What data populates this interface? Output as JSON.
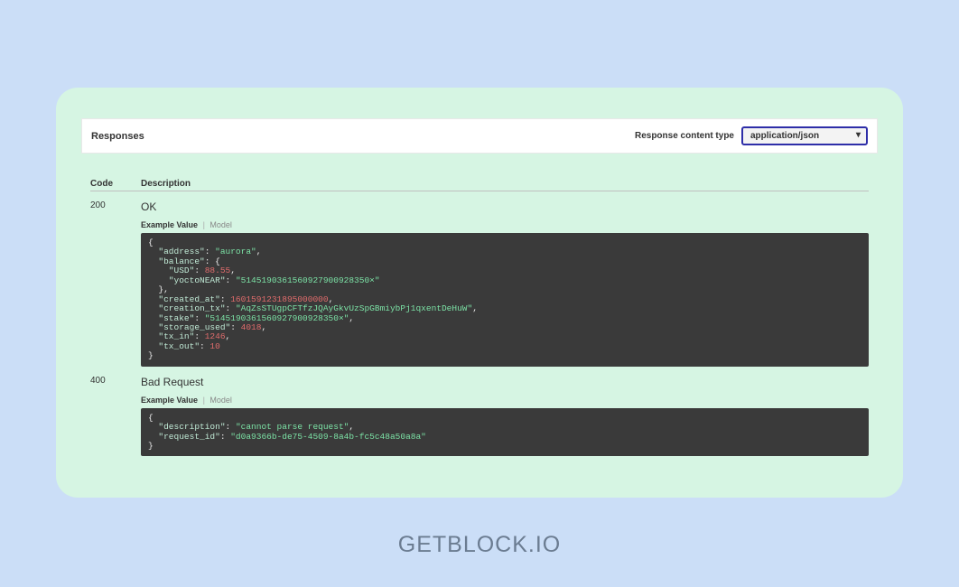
{
  "header": {
    "title": "Responses",
    "content_type_label": "Response content type",
    "content_type_value": "application/json"
  },
  "columns": {
    "code": "Code",
    "description": "Description"
  },
  "rows": [
    {
      "code": "200",
      "status": "OK",
      "tab_active": "Example Value",
      "tab_inactive": "Model",
      "example": {
        "address": "aurora",
        "balance": {
          "USD": 88.55,
          "yoctoNEAR": "5145190361560927900928350×"
        },
        "created_at": 1601591231895000000,
        "creation_tx": "AqZsSTUgpCFTfzJQAyGkvUzSpGBmiybPj1qxentDeHuW",
        "stake": "5145190361560927900928350×",
        "storage_used": 4018,
        "tx_in": 1246,
        "tx_out": 10
      }
    },
    {
      "code": "400",
      "status": "Bad Request",
      "tab_active": "Example Value",
      "tab_inactive": "Model",
      "example": {
        "description": "cannot parse request",
        "request_id": "d0a9366b-de75-4509-8a4b-fc5c48a50a8a"
      }
    }
  ],
  "brand": "GETBLOCK.IO",
  "code_tokens": {
    "r200": [
      {
        "c": "punct",
        "t": "{"
      },
      {
        "c": "punct",
        "t": "\n  "
      },
      {
        "c": "key",
        "t": "\"address\""
      },
      {
        "c": "punct",
        "t": ": "
      },
      {
        "c": "str",
        "t": "\"aurora\""
      },
      {
        "c": "punct",
        "t": ","
      },
      {
        "c": "punct",
        "t": "\n  "
      },
      {
        "c": "key",
        "t": "\"balance\""
      },
      {
        "c": "punct",
        "t": ": {"
      },
      {
        "c": "punct",
        "t": "\n    "
      },
      {
        "c": "key",
        "t": "\"USD\""
      },
      {
        "c": "punct",
        "t": ": "
      },
      {
        "c": "num",
        "t": "88.55"
      },
      {
        "c": "punct",
        "t": ","
      },
      {
        "c": "punct",
        "t": "\n    "
      },
      {
        "c": "key",
        "t": "\"yoctoNEAR\""
      },
      {
        "c": "punct",
        "t": ": "
      },
      {
        "c": "str",
        "t": "\"5145190361560927900928350×\""
      },
      {
        "c": "punct",
        "t": "\n  },"
      },
      {
        "c": "punct",
        "t": "\n  "
      },
      {
        "c": "key",
        "t": "\"created_at\""
      },
      {
        "c": "punct",
        "t": ": "
      },
      {
        "c": "num",
        "t": "1601591231895000000"
      },
      {
        "c": "punct",
        "t": ","
      },
      {
        "c": "punct",
        "t": "\n  "
      },
      {
        "c": "key",
        "t": "\"creation_tx\""
      },
      {
        "c": "punct",
        "t": ": "
      },
      {
        "c": "str",
        "t": "\"AqZsSTUgpCFTfzJQAyGkvUzSpGBmiybPj1qxentDeHuW\""
      },
      {
        "c": "punct",
        "t": ","
      },
      {
        "c": "punct",
        "t": "\n  "
      },
      {
        "c": "key",
        "t": "\"stake\""
      },
      {
        "c": "punct",
        "t": ": "
      },
      {
        "c": "str",
        "t": "\"5145190361560927900928350×\""
      },
      {
        "c": "punct",
        "t": ","
      },
      {
        "c": "punct",
        "t": "\n  "
      },
      {
        "c": "key",
        "t": "\"storage_used\""
      },
      {
        "c": "punct",
        "t": ": "
      },
      {
        "c": "num",
        "t": "4018"
      },
      {
        "c": "punct",
        "t": ","
      },
      {
        "c": "punct",
        "t": "\n  "
      },
      {
        "c": "key",
        "t": "\"tx_in\""
      },
      {
        "c": "punct",
        "t": ": "
      },
      {
        "c": "num",
        "t": "1246"
      },
      {
        "c": "punct",
        "t": ","
      },
      {
        "c": "punct",
        "t": "\n  "
      },
      {
        "c": "key",
        "t": "\"tx_out\""
      },
      {
        "c": "punct",
        "t": ": "
      },
      {
        "c": "num",
        "t": "10"
      },
      {
        "c": "punct",
        "t": "\n}"
      }
    ],
    "r400": [
      {
        "c": "punct",
        "t": "{"
      },
      {
        "c": "punct",
        "t": "\n  "
      },
      {
        "c": "key",
        "t": "\"description\""
      },
      {
        "c": "punct",
        "t": ": "
      },
      {
        "c": "str",
        "t": "\"cannot parse request\""
      },
      {
        "c": "punct",
        "t": ","
      },
      {
        "c": "punct",
        "t": "\n  "
      },
      {
        "c": "key",
        "t": "\"request_id\""
      },
      {
        "c": "punct",
        "t": ": "
      },
      {
        "c": "str",
        "t": "\"d0a9366b-de75-4509-8a4b-fc5c48a50a8a\""
      },
      {
        "c": "punct",
        "t": "\n}"
      }
    ]
  }
}
